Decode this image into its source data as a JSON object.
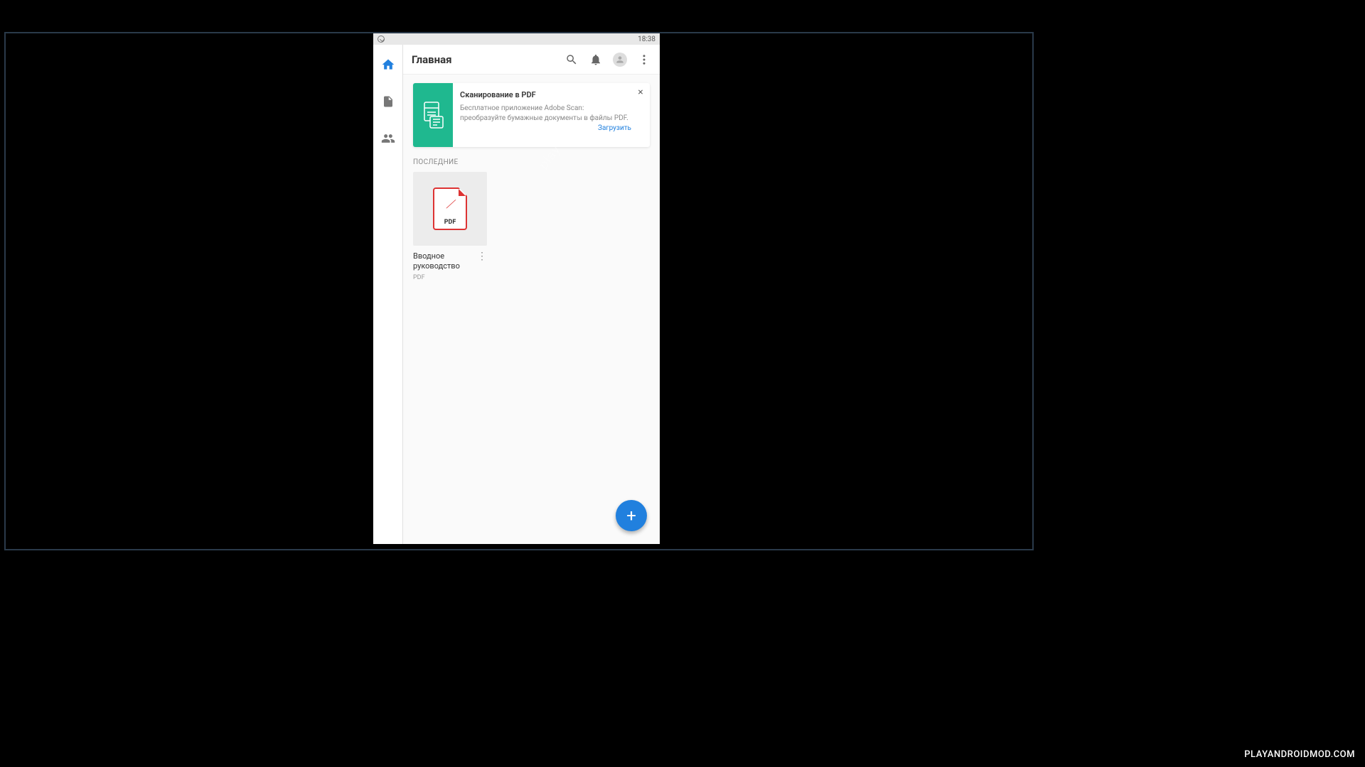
{
  "status_bar": {
    "time": "18:38"
  },
  "sidebar": {
    "items": [
      {
        "name": "home",
        "active": true
      },
      {
        "name": "files",
        "active": false
      },
      {
        "name": "shared",
        "active": false
      }
    ]
  },
  "header": {
    "title": "Главная"
  },
  "promo": {
    "title": "Сканирование в PDF",
    "description": "Бесплатное приложение Adobe Scan: преобразуйте бумажные документы в файлы PDF.",
    "link_label": "Загрузить"
  },
  "sections": {
    "recent_label": "ПОСЛЕДНИЕ"
  },
  "files": [
    {
      "name": "Вводное руководство",
      "type": "PDF",
      "badge": "PDF"
    }
  ],
  "fab": {
    "label": "+"
  },
  "footer": {
    "source": "PLAYANDROIDMOD.COM"
  }
}
